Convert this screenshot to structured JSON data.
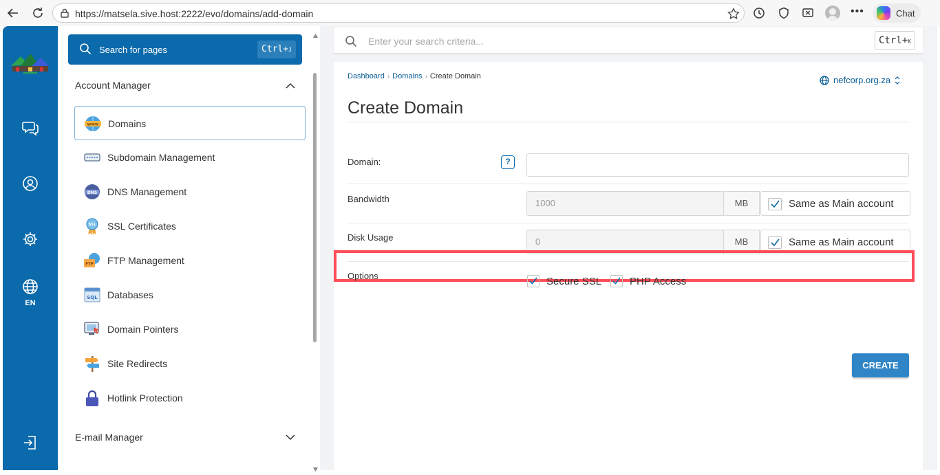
{
  "browser": {
    "url": "https://matsela.sive.host:2222/evo/domains/add-domain",
    "chat_label": "Chat",
    "icons": [
      "back-icon",
      "reload-icon",
      "lock-icon",
      "star-icon",
      "history-icon",
      "shield-icon",
      "screenshot-icon",
      "profile-icon",
      "more-icon",
      "copilot-icon"
    ]
  },
  "rail": {
    "items": [
      "messages-icon",
      "user-icon",
      "settings-icon",
      "globe-icon"
    ],
    "language": "EN",
    "logout": "logout-icon",
    "color": "#0b6aab"
  },
  "sidebar": {
    "search_label": "Search for pages",
    "search_shortcut_main": "Ctrl+",
    "search_shortcut_key": "J",
    "account_section": "Account Manager",
    "items": [
      {
        "label": "Domains",
        "icon": "www-globe-icon",
        "active": true
      },
      {
        "label": "Subdomain Management",
        "icon": "subdomain-icon",
        "active": false
      },
      {
        "label": "DNS Management",
        "icon": "dns-icon",
        "active": false
      },
      {
        "label": "SSL Certificates",
        "icon": "ssl-badge-icon",
        "active": false
      },
      {
        "label": "FTP Management",
        "icon": "ftp-folder-icon",
        "active": false
      },
      {
        "label": "Databases",
        "icon": "sql-database-icon",
        "active": false
      },
      {
        "label": "Domain Pointers",
        "icon": "monitor-pointer-icon",
        "active": false
      },
      {
        "label": "Site Redirects",
        "icon": "signpost-icon",
        "active": false
      },
      {
        "label": "Hotlink Protection",
        "icon": "padlock-icon",
        "active": false
      }
    ],
    "email_section": "E-mail Manager"
  },
  "topsearch": {
    "placeholder": "Enter your search criteria...",
    "shortcut_main": "Ctrl+",
    "shortcut_key": "K"
  },
  "main": {
    "breadcrumb": [
      "Dashboard",
      "Domains",
      "Create Domain"
    ],
    "site": "nefcorp.org.za",
    "title": "Create Domain",
    "domain": {
      "label": "Domain:",
      "value": "",
      "help": "?"
    },
    "bandwidth": {
      "label": "Bandwidth",
      "value": "1000",
      "unit": "MB",
      "same_label": "Same as Main account",
      "same_checked": true
    },
    "disk": {
      "label": "Disk Usage",
      "value": "0",
      "unit": "MB",
      "same_label": "Same as Main account",
      "same_checked": true
    },
    "options": {
      "label": "Options",
      "secure_ssl": "Secure SSL",
      "php_access": "PHP Access",
      "secure_ssl_checked": true,
      "php_access_checked": true
    },
    "create_label": "CREATE",
    "accent": "#2f85c6",
    "highlight_color": "#ff4d5a"
  }
}
